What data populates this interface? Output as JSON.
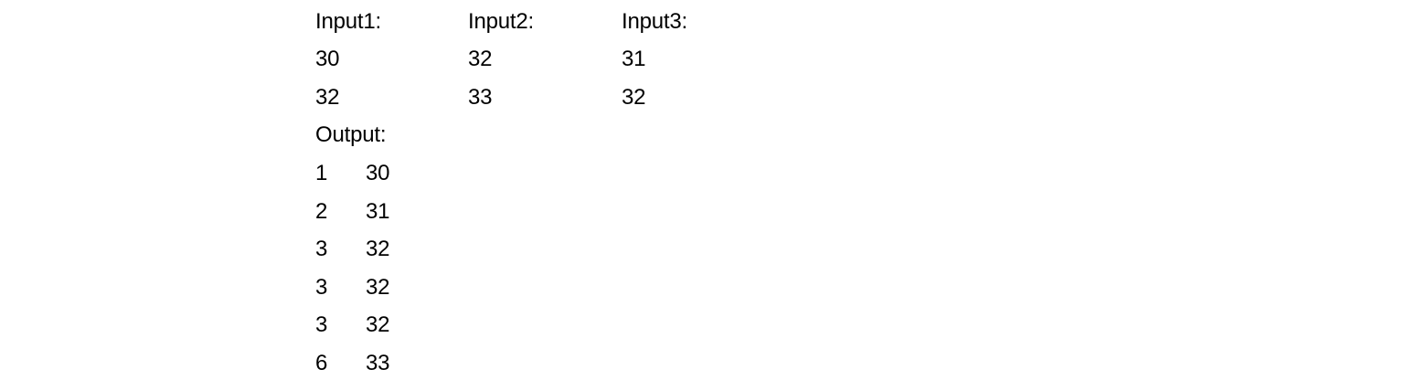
{
  "inputs": {
    "headers": [
      "Input1:",
      "Input2:",
      "Input3:"
    ],
    "rows": [
      [
        "30",
        "32",
        "31"
      ],
      [
        "32",
        "33",
        "32"
      ]
    ]
  },
  "output": {
    "header": "Output:",
    "rows": [
      [
        "1",
        "30"
      ],
      [
        "2",
        "31"
      ],
      [
        "3",
        "32"
      ],
      [
        "3",
        "32"
      ],
      [
        "3",
        "32"
      ],
      [
        "6",
        "33"
      ]
    ]
  }
}
